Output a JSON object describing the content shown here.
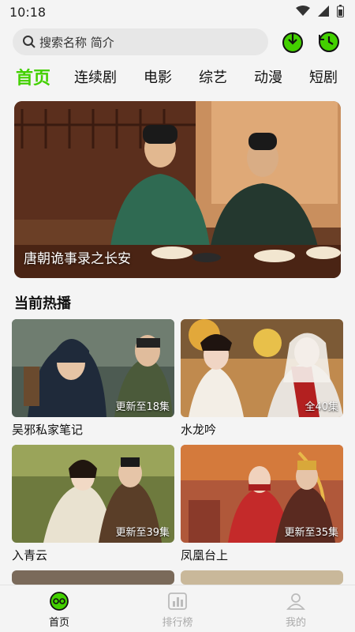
{
  "status": {
    "time": "10:18"
  },
  "search": {
    "placeholder": "搜索名称 简介"
  },
  "tabs": [
    {
      "label": "首页",
      "active": true
    },
    {
      "label": "连续剧"
    },
    {
      "label": "电影"
    },
    {
      "label": "综艺"
    },
    {
      "label": "动漫"
    },
    {
      "label": "短剧"
    }
  ],
  "hero": {
    "title": "唐朝诡事录之长安"
  },
  "section": {
    "title": "当前热播"
  },
  "cards": [
    {
      "name": "吴邪私家笔记",
      "episodes": "更新至18集"
    },
    {
      "name": "水龙吟",
      "episodes": "全40集"
    },
    {
      "name": "入青云",
      "episodes": "更新至39集"
    },
    {
      "name": "凤凰台上",
      "episodes": "更新至35集"
    }
  ],
  "nav": [
    {
      "label": "首页",
      "active": true
    },
    {
      "label": "排行榜"
    },
    {
      "label": "我的"
    }
  ],
  "colors": {
    "accent": "#43d000"
  }
}
